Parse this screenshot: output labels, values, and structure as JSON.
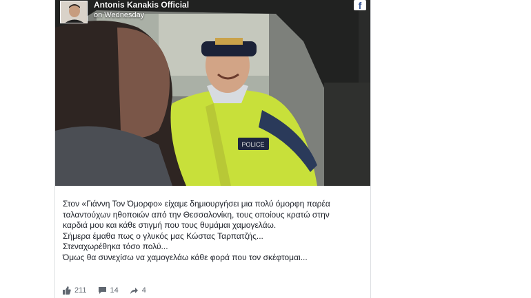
{
  "post": {
    "page_name": "Antonis Kanakis Official",
    "time": "on Wednesday",
    "fb_badge": "f",
    "text_lines": [
      "Στον «Γιάννη Τον Όμορφο» είχαμε δημιουργήσει μια πολύ όμορφη παρέα",
      "ταλαντούχων ηθοποιών από την Θεσσαλονίκη, τους οποίους κρατώ στην",
      "καρδιά μου και κάθε στιγμή που τους θυμάμαι χαμογελάω.",
      "Σήμερα έμαθα πως ο γλυκός μας Κώστας Ταρπατζής...",
      "Στεναχωρέθηκα τόσο πολύ...",
      "Όμως θα συνεχίσω να χαμογελάω κάθε φορά που τον σκέφτομαι..."
    ],
    "vest_label": "POLICE",
    "stats": {
      "likes": "211",
      "comments": "14",
      "shares": "4"
    }
  },
  "colors": {
    "text": "#1d2129",
    "meta": "#606770",
    "brand": "#3b5998",
    "vest": "#c8e03a"
  }
}
